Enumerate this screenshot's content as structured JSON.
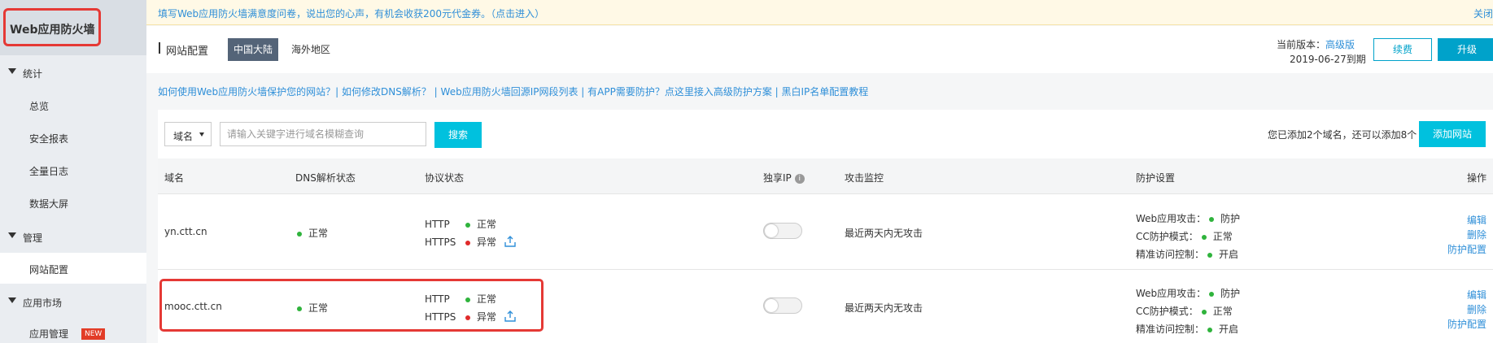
{
  "sidebar": {
    "title": "Web应用防火墙",
    "groups": [
      {
        "label": "统计",
        "items": [
          "总览",
          "安全报表",
          "全量日志",
          "数据大屏"
        ]
      },
      {
        "label": "管理",
        "items": [
          "网站配置"
        ]
      },
      {
        "label": "应用市场",
        "items": [
          "应用管理"
        ]
      }
    ],
    "new_badge": "NEW"
  },
  "notice": {
    "text": "填写Web应用防火墙满意度问卷，说出您的心声，有机会收获200元代金券。（点击进入）",
    "close": "关闭"
  },
  "header": {
    "title": "网站配置",
    "tabs": [
      "中国大陆",
      "海外地区"
    ],
    "version_label": "当前版本：",
    "version_value": "高级版",
    "expiry": "2019-06-27到期",
    "renew_label": "续费",
    "upgrade_label": "升级"
  },
  "help_links": "如何使用Web应用防火墙保护您的网站？| 如何修改DNS解析？ | Web应用防火墙回源IP网段列表 | 有APP需要防护？点这里接入高级防护方案 | 黑白IP名单配置教程",
  "toolbar": {
    "select_value": "域名",
    "search_placeholder": "请输入关键字进行域名模糊查询",
    "search_label": "搜索",
    "count_text": "您已添加2个域名，还可以添加8个",
    "add_label": "添加网站"
  },
  "table": {
    "headers": {
      "domain": "域名",
      "dns": "DNS解析状态",
      "protocol": "协议状态",
      "ip": "独享IP",
      "attack": "攻击监控",
      "protection": "防护设置",
      "action": "操作"
    },
    "rows": [
      {
        "domain": "yn.ctt.cn",
        "dns": "正常",
        "http_label": "HTTP",
        "http_status": "正常",
        "https_label": "HTTPS",
        "https_status": "异常",
        "attack": "最近两天内无攻击",
        "prot_web": "Web应用攻击：",
        "prot_web_val": "防护",
        "prot_cc": "CC防护模式：",
        "prot_cc_val": "正常",
        "prot_acl": "精准访问控制：",
        "prot_acl_val": "开启",
        "act_edit": "编辑",
        "act_delete": "删除",
        "act_config": "防护配置"
      },
      {
        "domain": "mooc.ctt.cn",
        "dns": "正常",
        "http_label": "HTTP",
        "http_status": "正常",
        "https_label": "HTTPS",
        "https_status": "异常",
        "attack": "最近两天内无攻击",
        "prot_web": "Web应用攻击：",
        "prot_web_val": "防护",
        "prot_cc": "CC防护模式：",
        "prot_cc_val": "正常",
        "prot_acl": "精准访问控制：",
        "prot_acl_val": "开启",
        "act_edit": "编辑",
        "act_delete": "删除",
        "act_config": "防护配置"
      }
    ]
  },
  "colors": {
    "accent": "#00c1de",
    "link": "#2f8fd8",
    "ok": "#2fb33c",
    "error": "#e02a2a",
    "highlight": "#e53935"
  }
}
